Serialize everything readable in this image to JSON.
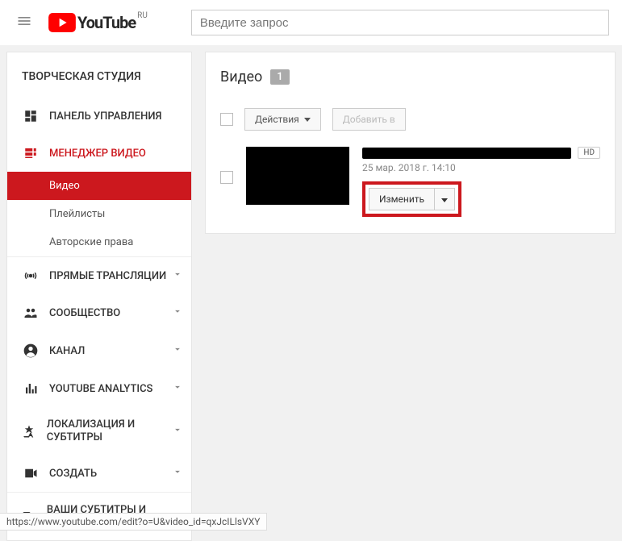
{
  "header": {
    "logo_text": "YouTube",
    "region": "RU",
    "search_placeholder": "Введите запрос"
  },
  "sidebar": {
    "studio_title": "ТВОРЧЕСКАЯ СТУДИЯ",
    "items": [
      {
        "label": "ПАНЕЛЬ УПРАВЛЕНИЯ",
        "icon": "dashboard"
      },
      {
        "label": "МЕНЕДЖЕР ВИДЕО",
        "icon": "video-manager",
        "active": true,
        "children": [
          {
            "label": "Видео",
            "selected": true
          },
          {
            "label": "Плейлисты"
          },
          {
            "label": "Авторские права"
          }
        ]
      },
      {
        "label": "ПРЯМЫЕ ТРАНСЛЯЦИИ",
        "icon": "live",
        "expandable": true
      },
      {
        "label": "СООБЩЕСТВО",
        "icon": "community",
        "expandable": true
      },
      {
        "label": "КАНАЛ",
        "icon": "channel",
        "expandable": true
      },
      {
        "label": "YOUTUBE ANALYTICS",
        "icon": "analytics",
        "expandable": true
      },
      {
        "label": "ЛОКАЛИЗАЦИЯ И СУБТИТРЫ",
        "icon": "translate",
        "expandable": true
      },
      {
        "label": "СОЗДАТЬ",
        "icon": "create",
        "expandable": true
      },
      {
        "label": "ВАШИ СУБТИТРЫ И ПЕРЕВОДЫ",
        "icon": "your-translations"
      }
    ]
  },
  "main": {
    "title": "Видео",
    "count": "1",
    "actions_button": "Действия",
    "add_to_button": "Добавить в",
    "video": {
      "date": "25 мар. 2018 г. 14:10",
      "hd_badge": "HD",
      "edit_button": "Изменить"
    }
  },
  "status_url": "https://www.youtube.com/edit?o=U&video_id=qxJcILlsVXY"
}
